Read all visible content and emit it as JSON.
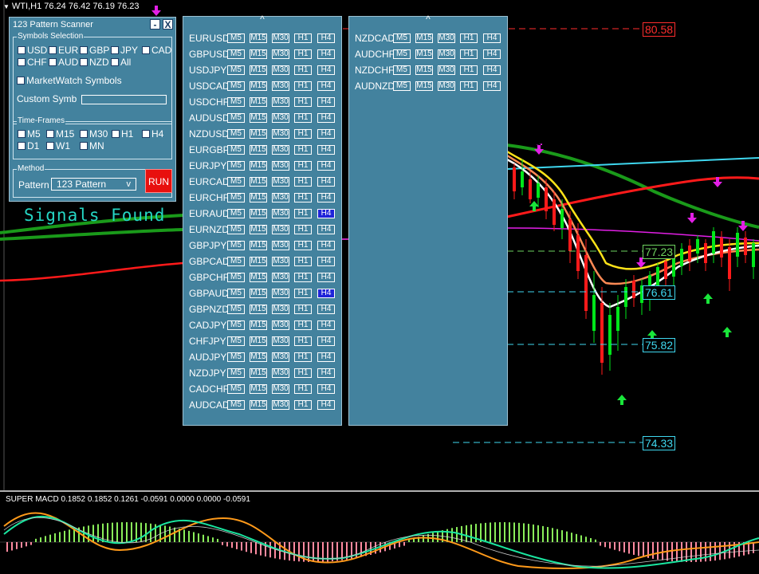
{
  "chart": {
    "symbol_line": "WTI,H1  76.24 76.42 76.19 76.23",
    "signals_text": "Signals Found",
    "price_labels": [
      {
        "value": "80.58",
        "style": "red"
      },
      {
        "value": "77.23",
        "style": "green"
      },
      {
        "value": "76.61",
        "style": "cyan"
      },
      {
        "value": "75.82",
        "style": "cyan"
      },
      {
        "value": "74.33",
        "style": "cyan"
      }
    ],
    "macd_label": "SUPER MACD 0.1852 0.1852 0.1261 -0.0591 0.0000 0.0000 -0.0591",
    "colors": {
      "bull": "#00e61a",
      "bear": "#ff1a1a",
      "sell_arrow": "#e21fe6",
      "buy_arrow": "#19e63a",
      "background": "#000000"
    }
  },
  "scanner": {
    "title": "123 Pattern Scanner",
    "minimize_label": "-",
    "close_label": "X",
    "symbols_group_label": "Symbols Selection",
    "symbols": [
      "USD",
      "EUR",
      "GBP",
      "JPY",
      "CAD",
      "CHF",
      "AUD",
      "NZD",
      "All"
    ],
    "marketwatch_label": "MarketWatch Symbols",
    "custom_label": "Custom Symb",
    "custom_value": "",
    "timeframes_group_label": "Time-Frames",
    "timeframes": [
      "M5",
      "M15",
      "M30",
      "H1",
      "H4",
      "D1",
      "W1",
      "MN"
    ],
    "method_group_label": "Method",
    "pattern_label": "Pattern",
    "pattern_value": "123 Pattern",
    "pattern_arrow": "v",
    "run_label": "RUN"
  },
  "grid": {
    "caret": "^",
    "tf_labels": [
      "M5",
      "M15",
      "M30",
      "H1",
      "H4"
    ],
    "left_rows": [
      {
        "symbol": "EURUSD"
      },
      {
        "symbol": "GBPUSD"
      },
      {
        "symbol": "USDJPY"
      },
      {
        "symbol": "USDCAD"
      },
      {
        "symbol": "USDCHF"
      },
      {
        "symbol": "AUDUSD"
      },
      {
        "symbol": "NZDUSD"
      },
      {
        "symbol": "EURGBP"
      },
      {
        "symbol": "EURJPY"
      },
      {
        "symbol": "EURCAD"
      },
      {
        "symbol": "EURCHF"
      },
      {
        "symbol": "EURAUD",
        "active": "H4"
      },
      {
        "symbol": "EURNZD"
      },
      {
        "symbol": "GBPJPY"
      },
      {
        "symbol": "GBPCAD"
      },
      {
        "symbol": "GBPCHF"
      },
      {
        "symbol": "GBPAUD",
        "active": "H4"
      },
      {
        "symbol": "GBPNZD"
      },
      {
        "symbol": "CADJPY"
      },
      {
        "symbol": "CHFJPY"
      },
      {
        "symbol": "AUDJPY"
      },
      {
        "symbol": "NZDJPY"
      },
      {
        "symbol": "CADCHF"
      },
      {
        "symbol": "AUDCAD"
      }
    ],
    "right_rows": [
      {
        "symbol": "NZDCAD"
      },
      {
        "symbol": "AUDCHF"
      },
      {
        "symbol": "NZDCHF"
      },
      {
        "symbol": "AUDNZD"
      }
    ]
  }
}
